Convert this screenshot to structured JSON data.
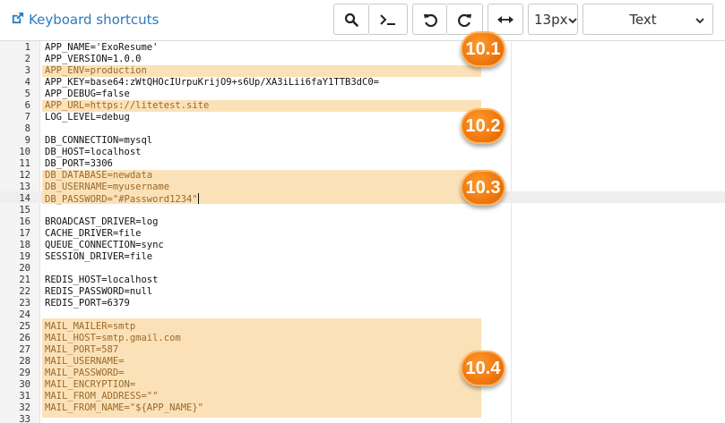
{
  "toolbar": {
    "shortcuts_label": "Keyboard shortcuts",
    "font_size": "13px",
    "mode": "Text",
    "buttons": [
      "search-icon",
      "terminal-icon",
      "undo-icon",
      "redo-icon",
      "wrap-icon"
    ]
  },
  "editor": {
    "lines": [
      {
        "n": "1",
        "text": "APP_NAME='ExoResume'"
      },
      {
        "n": "2",
        "text": "APP_VERSION=1.0.0"
      },
      {
        "n": "3",
        "text": "APP_ENV=production"
      },
      {
        "n": "4",
        "text": "APP_KEY=base64:zWtQHOcIUrpuKrijO9+s6Up/XA3iLii6faY1TTB3dC0="
      },
      {
        "n": "5",
        "text": "APP_DEBUG=false"
      },
      {
        "n": "6",
        "text": "APP_URL=https://litetest.site"
      },
      {
        "n": "7",
        "text": "LOG_LEVEL=debug"
      },
      {
        "n": "8",
        "text": ""
      },
      {
        "n": "9",
        "text": "DB_CONNECTION=mysql"
      },
      {
        "n": "10",
        "text": "DB_HOST=localhost"
      },
      {
        "n": "11",
        "text": "DB_PORT=3306"
      },
      {
        "n": "12",
        "text": "DB_DATABASE=newdata"
      },
      {
        "n": "13",
        "text": "DB_USERNAME=myusername"
      },
      {
        "n": "14",
        "text": "DB_PASSWORD=\"#Password1234\""
      },
      {
        "n": "15",
        "text": ""
      },
      {
        "n": "16",
        "text": "BROADCAST_DRIVER=log"
      },
      {
        "n": "17",
        "text": "CACHE_DRIVER=file"
      },
      {
        "n": "18",
        "text": "QUEUE_CONNECTION=sync"
      },
      {
        "n": "19",
        "text": "SESSION_DRIVER=file"
      },
      {
        "n": "20",
        "text": ""
      },
      {
        "n": "21",
        "text": "REDIS_HOST=localhost"
      },
      {
        "n": "22",
        "text": "REDIS_PASSWORD=null"
      },
      {
        "n": "23",
        "text": "REDIS_PORT=6379"
      },
      {
        "n": "24",
        "text": ""
      },
      {
        "n": "25",
        "text": "MAIL_MAILER=smtp"
      },
      {
        "n": "26",
        "text": "MAIL_HOST=smtp.gmail.com"
      },
      {
        "n": "27",
        "text": "MAIL_PORT=587"
      },
      {
        "n": "28",
        "text": "MAIL_USERNAME="
      },
      {
        "n": "29",
        "text": "MAIL_PASSWORD="
      },
      {
        "n": "30",
        "text": "MAIL_ENCRYPTION="
      },
      {
        "n": "31",
        "text": "MAIL_FROM_ADDRESS=\"\""
      },
      {
        "n": "32",
        "text": "MAIL_FROM_NAME=\"${APP_NAME}\""
      },
      {
        "n": "33",
        "text": ""
      }
    ],
    "highlighted_lines": [
      3,
      6,
      12,
      13,
      14,
      25,
      26,
      27,
      28,
      29,
      30,
      31,
      32
    ],
    "cursor_line": 14
  },
  "badges": [
    "10.1",
    "10.2",
    "10.3",
    "10.4"
  ],
  "colors": {
    "highlight": "#fbe1b8",
    "badge": "#f07a10",
    "link": "#2b7bbf"
  }
}
